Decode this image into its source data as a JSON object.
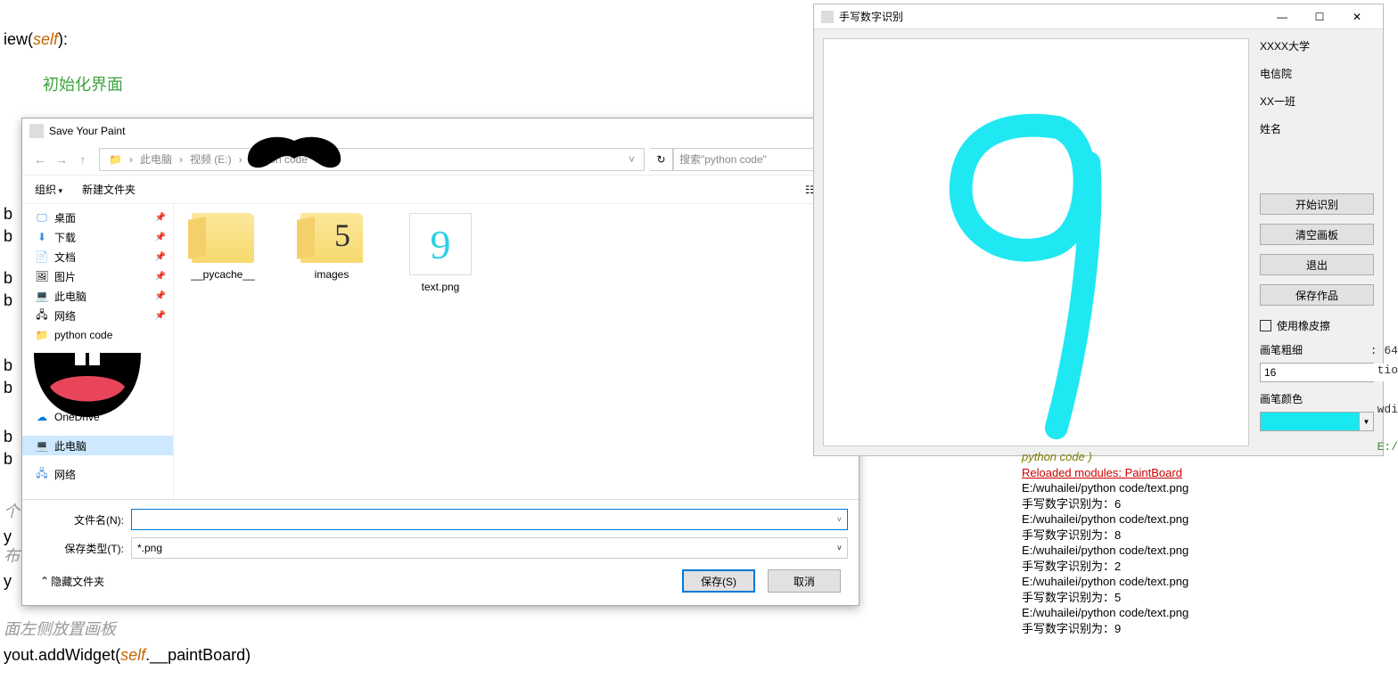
{
  "code": {
    "l1a": "iew(",
    "l1b": "self",
    "l1c": "):",
    "l2": "初始化界面",
    "l3": "yout.addWidget(",
    "l3b": "self",
    "l3c": ".__paintBoard)",
    "c1": "面左侧放置画板"
  },
  "dialog": {
    "title": "Save Your Paint",
    "path": {
      "p1": "此电脑",
      "p2": "视频 (E:)",
      "p3": "python code"
    },
    "search_placeholder": "搜索\"python code\"",
    "org": "组织",
    "newf": "新建文件夹",
    "side": {
      "desktop": "桌面",
      "download": "下载",
      "docs": "文档",
      "pics": "图片",
      "thispc": "此电脑",
      "network": "网络",
      "pycode": "python code",
      "onedrive": "OneDrive",
      "thispc2": "此电脑",
      "network2": "网络"
    },
    "files": {
      "f1": "__pycache__",
      "f2": "images",
      "f3": "text.png"
    },
    "fn_label": "文件名(N):",
    "type_label": "保存类型(T):",
    "type_val": "*.png",
    "hide": "隐藏文件夹",
    "save": "保存(S)",
    "cancel": "取消"
  },
  "recog": {
    "title": "手写数字识别",
    "uni": "XXXX大学",
    "college": "电信院",
    "cls": "XX一班",
    "name": "姓名",
    "btn_start": "开始识别",
    "btn_clear": "清空画板",
    "btn_exit": "退出",
    "btn_save": "保存作品",
    "eraser": "使用橡皮擦",
    "thick_label": "画笔粗细",
    "thick_val": "16",
    "color_label": "画笔颜色"
  },
  "console": {
    "l0": "python code )",
    "l1": "Reloaded modules: PaintBoard",
    "runs": [
      {
        "path": "E:/wuhailei/python code/text.png",
        "res": "手写数字识别为：6"
      },
      {
        "path": "E:/wuhailei/python code/text.png",
        "res": "手写数字识别为：8"
      },
      {
        "path": "E:/wuhailei/python code/text.png",
        "res": "手写数字识别为：2"
      },
      {
        "path": "E:/wuhailei/python code/text.png",
        "res": "手写数字识别为：5"
      },
      {
        "path": "E:/wuhailei/python code/text.png",
        "res": "手写数字识别为：9"
      }
    ]
  },
  "edge": {
    "e1": ": 64",
    "e2": "tio",
    "e3": "wdi",
    "e4": "E:/"
  }
}
